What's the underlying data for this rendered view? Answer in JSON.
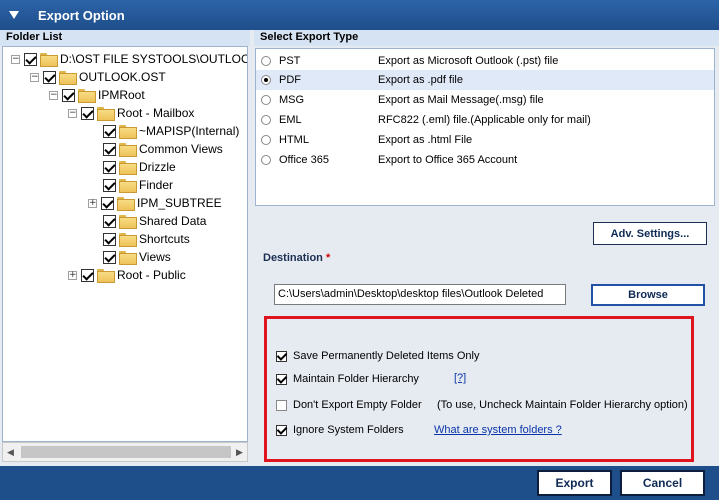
{
  "window": {
    "title": "Export Option"
  },
  "folder_list": {
    "header": "Folder List",
    "tree": [
      {
        "label": "D:\\OST FILE SYSTOOLS\\OUTLOOK.",
        "expander": "−"
      },
      {
        "label": "OUTLOOK.OST",
        "expander": "−"
      },
      {
        "label": "IPMRoot",
        "expander": "−"
      },
      {
        "label": "Root - Mailbox",
        "expander": "−"
      },
      {
        "label": "~MAPISP(Internal)",
        "expander": ""
      },
      {
        "label": "Common Views",
        "expander": ""
      },
      {
        "label": "Drizzle",
        "expander": ""
      },
      {
        "label": "Finder",
        "expander": ""
      },
      {
        "label": "IPM_SUBTREE",
        "expander": "+"
      },
      {
        "label": "Shared Data",
        "expander": ""
      },
      {
        "label": "Shortcuts",
        "expander": ""
      },
      {
        "label": "Views",
        "expander": ""
      },
      {
        "label": "Root - Public",
        "expander": "+"
      }
    ]
  },
  "export_type": {
    "header": "Select Export Type",
    "options": [
      {
        "name": "PST",
        "desc": "Export as Microsoft Outlook (.pst) file"
      },
      {
        "name": "PDF",
        "desc": "Export as .pdf file"
      },
      {
        "name": "MSG",
        "desc": "Export as Mail Message(.msg) file"
      },
      {
        "name": "EML",
        "desc": "RFC822 (.eml) file.(Applicable only for mail)"
      },
      {
        "name": "HTML",
        "desc": "Export as .html File"
      },
      {
        "name": "Office 365",
        "desc": "Export to Office 365 Account"
      }
    ],
    "selected": "PDF"
  },
  "buttons": {
    "adv_settings": "Adv. Settings...",
    "browse": "Browse",
    "export": "Export",
    "cancel": "Cancel"
  },
  "destination": {
    "label": "Destination",
    "required_mark": "*",
    "value": "C:\\Users\\admin\\Desktop\\desktop files\\Outlook Deleted"
  },
  "options": {
    "save_deleted": {
      "label": "Save Permanently Deleted Items Only",
      "checked": true
    },
    "maintain_hierarchy": {
      "label": "Maintain Folder Hierarchy",
      "checked": true,
      "help_link": "[?]"
    },
    "no_empty_folder": {
      "label": "Don't Export Empty Folder",
      "checked": false,
      "note": "(To use, Uncheck Maintain Folder Hierarchy option)"
    },
    "ignore_system": {
      "label": "Ignore System Folders",
      "checked": true,
      "link": "What are system folders ?"
    }
  },
  "colors": {
    "title_bar": "#1f4f8b",
    "panel_background": "#e6ebf2",
    "highlight_border": "#e0141e",
    "link": "#0a35a8"
  }
}
